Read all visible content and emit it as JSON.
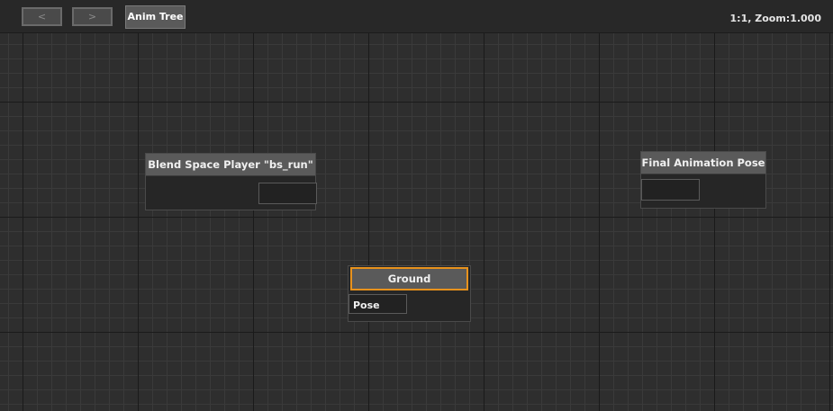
{
  "toolbar": {
    "back_glyph": "<",
    "forward_glyph": ">",
    "tab_label": "Anim Tree",
    "zoom_label": "1:1, Zoom:1.000"
  },
  "nodes": {
    "blend_space": {
      "title": "Blend Space Player \"bs_run\""
    },
    "final_pose": {
      "title": "Final Animation Pose"
    },
    "ground": {
      "title": "Ground",
      "pin_label": "Pose",
      "selected": true
    }
  },
  "colors": {
    "selection": "#e8921c",
    "background": "#2f2f2f",
    "node_header": "#5a5a5a"
  }
}
